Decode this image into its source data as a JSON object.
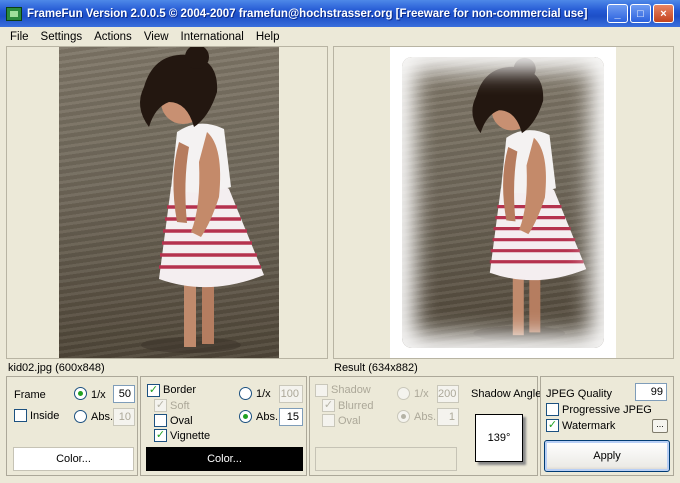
{
  "window": {
    "title": "FrameFun Version 2.0.0.5 © 2004-2007 framefun@hochstrasser.org [Freeware for non-commercial use]",
    "buttons": [
      "_",
      "□",
      "×"
    ]
  },
  "menu": [
    "File",
    "Settings",
    "Actions",
    "View",
    "International",
    "Help"
  ],
  "source_caption": "kid02.jpg (600x848)",
  "result_caption": "Result (634x882)",
  "frame": {
    "label": "Frame",
    "inside_label": "Inside",
    "inside_checked": false,
    "mode_1x_label": "1/x",
    "mode_abs_label": "Abs.",
    "mode_1x_value": "50",
    "mode_abs_value": "10",
    "selected": "1/x",
    "color_button": "Color..."
  },
  "border": {
    "label": "Border",
    "checked": true,
    "soft_label": "Soft",
    "soft_checked": true,
    "oval_label": "Oval",
    "oval_checked": false,
    "vignette_label": "Vignette",
    "vignette_checked": true,
    "mode_1x_label": "1/x",
    "mode_abs_label": "Abs.",
    "mode_1x_value": "100",
    "mode_abs_value": "15",
    "selected": "Abs.",
    "color_button": "Color...",
    "color": "#000000"
  },
  "shadow": {
    "label": "Shadow",
    "checked": false,
    "blurred_label": "Blurred",
    "blurred_checked": true,
    "oval_label": "Oval",
    "oval_checked": false,
    "mode_1x_label": "1/x",
    "mode_abs_label": "Abs.",
    "mode_1x_value": "200",
    "mode_abs_value": "1",
    "angle_label": "Shadow Angle",
    "angle_value": "139°"
  },
  "output": {
    "jpeg_quality_label": "JPEG Quality",
    "jpeg_quality_value": "99",
    "progressive_label": "Progressive JPEG",
    "progressive_checked": false,
    "watermark_label": "Watermark",
    "watermark_checked": true,
    "watermark_more": "...",
    "apply_button": "Apply"
  },
  "icons": {
    "app": "framefun-app-icon",
    "minimize": "minimize-icon",
    "maximize": "maximize-icon",
    "close": "close-icon"
  }
}
